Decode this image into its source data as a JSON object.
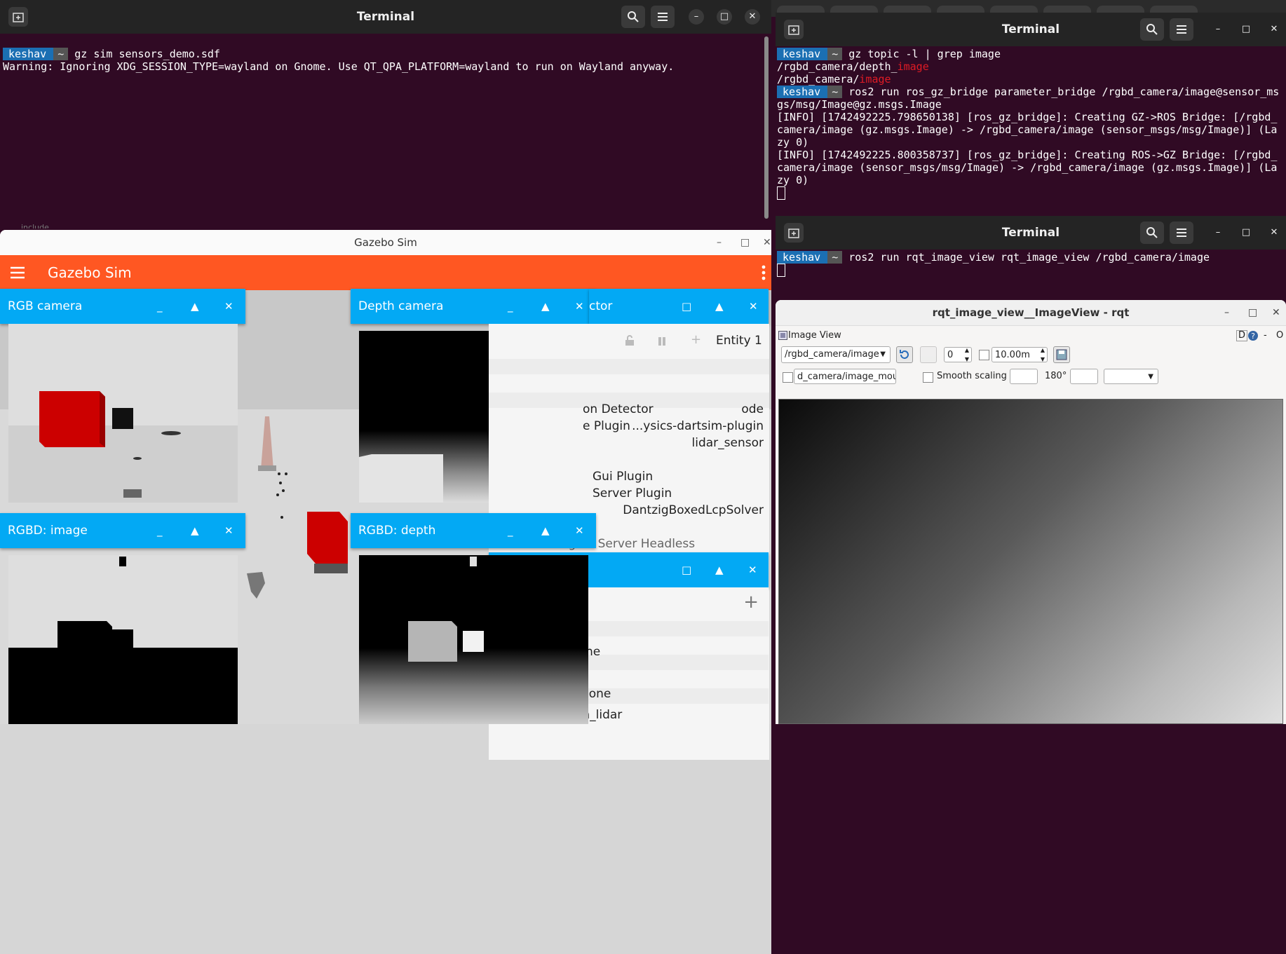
{
  "terminal1": {
    "title": "Terminal",
    "user": "keshav",
    "tilde": "~",
    "cmd": " gz sim sensors_demo.sdf",
    "line2": "Warning: Ignoring XDG_SESSION_TYPE=wayland on Gnome. Use QT_QPA_PLATFORM=wayland to run on Wayland anyway.",
    "peek": "include"
  },
  "terminal2": {
    "title": "Terminal",
    "user": "keshav",
    "tilde": "~",
    "cmd1": " gz topic -l | grep image",
    "out1a": "/rgbd_camera/depth_",
    "out1b": "image",
    "out2a": "/rgbd_camera/",
    "out2b": "image",
    "cmd2": " ros2 run ros_gz_bridge parameter_bridge /rgbd_camera/image@sensor_msgs/msg/Image@gz.msgs.Image",
    "info1": "[INFO] [1742492225.798650138] [ros_gz_bridge]: Creating GZ->ROS Bridge: [/rgbd_camera/image (gz.msgs.Image) -> /rgbd_camera/image (sensor_msgs/msg/Image)] (Lazy 0)",
    "info2": "[INFO] [1742492225.800358737] [ros_gz_bridge]: Creating ROS->GZ Bridge: [/rgbd_camera/image (sensor_msgs/msg/Image) -> /rgbd_camera/image (gz.msgs.Image)] (Lazy 0)"
  },
  "terminal3": {
    "title": "Terminal",
    "user": "keshav",
    "tilde": "~",
    "cmd": " ros2 run rqt_image_view rqt_image_view /rgbd_camera/image"
  },
  "gazebo": {
    "window_title": "Gazebo Sim",
    "app_title": "Gazebo Sim",
    "panels": {
      "rgb": "RGB camera",
      "depth": "Depth camera",
      "rgbd_image": "RGBD: image",
      "rgbd_depth": "RGBD: depth",
      "inspector_partial": "ctor"
    },
    "inspector": {
      "entity": "Entity 1",
      "rows": [
        {
          "label": "on Detector",
          "value": "ode"
        },
        {
          "label": "e Plugin",
          "value": "...ysics-dartsim-plugin"
        },
        {
          "label": "",
          "value": "lidar_sensor"
        },
        {
          "label": "Gui Plugin",
          "value": ""
        },
        {
          "label": "Server Plugin",
          "value": ""
        },
        {
          "label": "",
          "value": "DantzigBoxedLcpSolver"
        },
        {
          "label": "Render Engine Server Headless",
          "value": ""
        }
      ],
      "lower_rows": [
        "ne",
        "lone",
        "ch_lidar"
      ]
    }
  },
  "rqt": {
    "title": "rqt_image_view__ImageView - rqt",
    "plugin": "Image View",
    "dock_btns": "D",
    "topic": "/rgbd_camera/image",
    "spin_value": "0",
    "max_range": "10.00m",
    "mouse_topic": "d_camera/image_mouse_left",
    "smooth": "Smooth scaling",
    "rotation": "180°"
  }
}
